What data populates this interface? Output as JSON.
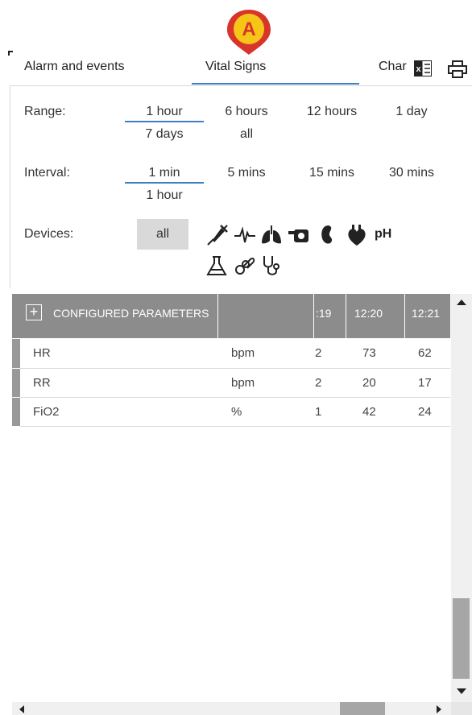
{
  "marker": {
    "letter": "A",
    "color": "#d9342b",
    "fill": "#f5c518"
  },
  "tabs": {
    "alarms": "Alarm and events",
    "vitals": "Vital Signs",
    "chart": "Char"
  },
  "filters": {
    "range_label": "Range:",
    "range_options": [
      "1 hour",
      "6 hours",
      "12 hours",
      "1 day",
      "7 days",
      "all"
    ],
    "range_selected": "1 hour",
    "interval_label": "Interval:",
    "interval_options": [
      "1 min",
      "5 mins",
      "15 mins",
      "30 mins",
      "1 hour"
    ],
    "interval_selected": "1 min",
    "devices_label": "Devices:",
    "devices_all": "all",
    "device_icons": [
      "syringe-icon",
      "heartbeat-icon",
      "lungs-icon",
      "monitor-icon",
      "kidney-icon",
      "heart-icon",
      "ph-icon",
      "flask-icon",
      "pacifier-icon",
      "stethoscope-icon"
    ],
    "ph_text": "pH"
  },
  "table": {
    "header_title": "CONFIGURED PARAMETERS",
    "columns": [
      ":19",
      "12:20",
      "12:21"
    ],
    "rows": [
      {
        "name": "HR",
        "unit": "bpm",
        "values": [
          "2",
          "73",
          "62"
        ]
      },
      {
        "name": "RR",
        "unit": "bpm",
        "values": [
          "2",
          "20",
          "17"
        ]
      },
      {
        "name": "FiO2",
        "unit": "%",
        "values": [
          "1",
          "42",
          "24"
        ]
      }
    ]
  },
  "colors": {
    "accent": "#3f7fc6",
    "header_bg": "#8c8c8c",
    "button_bg": "#d9d9d9"
  }
}
